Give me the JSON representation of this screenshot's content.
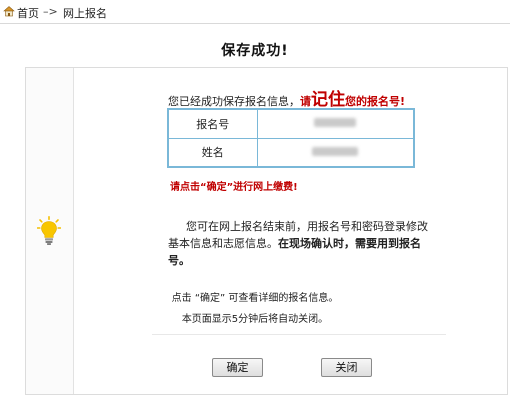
{
  "breadcrumb": {
    "home": "首页",
    "separator": "–>",
    "current": "网上报名"
  },
  "page_title": "保存成功!",
  "success_message": {
    "prefix": "您已经成功保存报名信息，",
    "emph_lead": "请",
    "emph_big": "记住",
    "emph_tail": "您的报名号!"
  },
  "info_table": {
    "rows": [
      {
        "label": "报名号"
      },
      {
        "label": "姓名"
      }
    ]
  },
  "notice_red": "请点击“确定”进行网上缴费!",
  "info_paragraph": {
    "normal": "您可在网上报名结束前，用报名号和密码登录修改基本信息和志愿信息。",
    "bold": "在现场确认时，需要用到报名号。"
  },
  "click_hint": "点击 “确定” 可查看详细的报名信息。",
  "autoclose_text": "本页面显示5分钟后将自动关闭。",
  "buttons": {
    "ok": "确定",
    "close": "关闭"
  },
  "colors": {
    "emphasis_red": "#c00000",
    "table_border": "#7ab8d8",
    "bulb": "#f5c000"
  },
  "icons": {
    "home": "home-icon",
    "bulb": "lightbulb-icon"
  }
}
